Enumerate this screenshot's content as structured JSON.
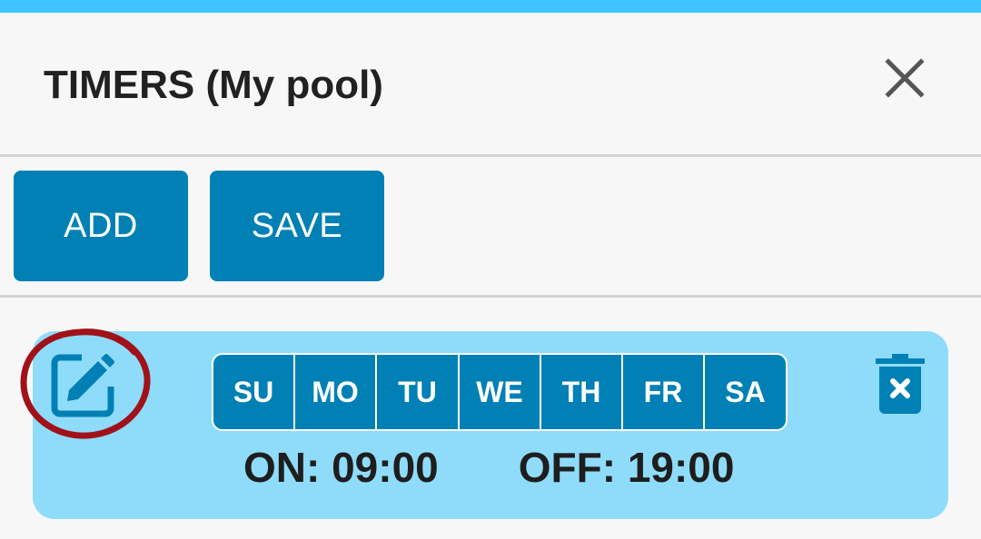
{
  "header": {
    "title": "TIMERS (My pool)",
    "close_icon": "close-icon"
  },
  "toolbar": {
    "add_label": "ADD",
    "save_label": "SAVE"
  },
  "timer": {
    "days": [
      "SU",
      "MO",
      "TU",
      "WE",
      "TH",
      "FR",
      "SA"
    ],
    "on_label": "ON: 09:00",
    "off_label": "OFF: 19:00",
    "edit_icon": "edit-icon",
    "delete_icon": "delete-icon"
  },
  "colors": {
    "top_bar": "#40c4ff",
    "button": "#0180b5",
    "card": "#8fdcfa",
    "annotation": "#a0121a"
  }
}
